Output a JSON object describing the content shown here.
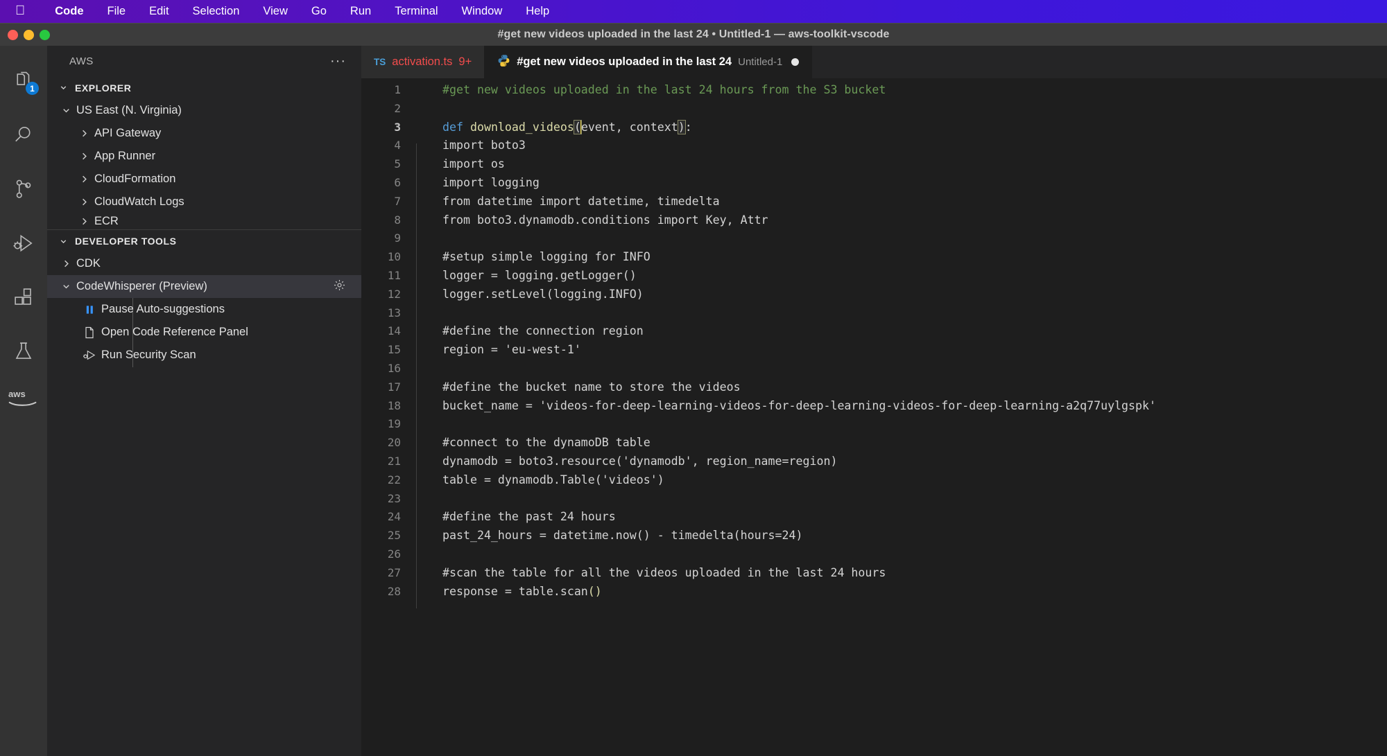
{
  "menubar": {
    "apple_icon": "apple-logo-icon",
    "items": [
      {
        "label": "Code",
        "bold": true
      },
      {
        "label": "File",
        "bold": false
      },
      {
        "label": "Edit",
        "bold": false
      },
      {
        "label": "Selection",
        "bold": false
      },
      {
        "label": "View",
        "bold": false
      },
      {
        "label": "Go",
        "bold": false
      },
      {
        "label": "Run",
        "bold": false
      },
      {
        "label": "Terminal",
        "bold": false
      },
      {
        "label": "Window",
        "bold": false
      },
      {
        "label": "Help",
        "bold": false
      }
    ]
  },
  "window": {
    "title": "#get new videos uploaded in the last 24 • Untitled-1 — aws-toolkit-vscode",
    "traffic_lights": [
      "close-red",
      "minimize-yellow",
      "zoom-green"
    ]
  },
  "activitybar": {
    "items": [
      {
        "name": "explorer-icon",
        "badge": "1"
      },
      {
        "name": "search-icon",
        "badge": ""
      },
      {
        "name": "source-control-icon",
        "badge": ""
      },
      {
        "name": "run-and-debug-icon",
        "badge": ""
      },
      {
        "name": "extensions-icon",
        "badge": ""
      },
      {
        "name": "testing-beaker-icon",
        "badge": ""
      }
    ],
    "aws_logo": "aws-icon"
  },
  "sidebar": {
    "title": "AWS",
    "more_actions": "···",
    "explorer": {
      "label": "EXPLORER",
      "expanded": true,
      "region": {
        "label": "US East (N. Virginia)",
        "expanded": true,
        "services": [
          {
            "label": "API Gateway",
            "expanded": false
          },
          {
            "label": "App Runner",
            "expanded": false
          },
          {
            "label": "CloudFormation",
            "expanded": false
          },
          {
            "label": "CloudWatch Logs",
            "expanded": false
          },
          {
            "label": "ECR",
            "expanded": false
          }
        ]
      }
    },
    "developer_tools": {
      "label": "DEVELOPER TOOLS",
      "expanded": true,
      "items": [
        {
          "label": "CDK",
          "expanded": false,
          "selected": false
        },
        {
          "label": "CodeWhisperer (Preview)",
          "expanded": true,
          "selected": true,
          "gear": "gear-icon"
        }
      ],
      "codewhisperer_actions": [
        {
          "label": "Pause Auto-suggestions",
          "icon": "pause-icon"
        },
        {
          "label": "Open Code Reference Panel",
          "icon": "file-icon"
        },
        {
          "label": "Run Security Scan",
          "icon": "security-scan-icon"
        }
      ]
    }
  },
  "tabs": [
    {
      "label": "activation.ts",
      "icon": "typescript-icon",
      "icon_text": "TS",
      "count": "9+",
      "active": false,
      "dirty": false
    },
    {
      "label": "#get new videos uploaded in the last 24",
      "icon": "python-icon",
      "sublabel": "Untitled-1",
      "active": true,
      "dirty": true
    }
  ],
  "code": {
    "language": "python",
    "cursor_line": 3,
    "lines": [
      {
        "n": "1",
        "indent": 0,
        "tokens": [
          {
            "t": "#get new videos uploaded in the last 24 hours from the S3 bucket",
            "c": "cm"
          }
        ]
      },
      {
        "n": "2",
        "indent": 0,
        "tokens": []
      },
      {
        "n": "3",
        "indent": 0,
        "current": true,
        "tokens": [
          {
            "t": "def ",
            "c": "kw"
          },
          {
            "t": "download_videos",
            "c": "fn"
          },
          {
            "t": "(",
            "c": "br"
          },
          {
            "t": "event, context",
            "c": "src"
          },
          {
            "t": ")",
            "c": "br"
          },
          {
            "t": ":",
            "c": "src"
          }
        ]
      },
      {
        "n": "4",
        "indent": 1,
        "tokens": [
          {
            "t": "import boto3",
            "c": "src"
          }
        ]
      },
      {
        "n": "5",
        "indent": 1,
        "tokens": [
          {
            "t": "import os",
            "c": "src"
          }
        ]
      },
      {
        "n": "6",
        "indent": 1,
        "tokens": [
          {
            "t": "import logging",
            "c": "src"
          }
        ]
      },
      {
        "n": "7",
        "indent": 1,
        "tokens": [
          {
            "t": "from datetime import datetime, timedelta",
            "c": "src"
          }
        ]
      },
      {
        "n": "8",
        "indent": 1,
        "tokens": [
          {
            "t": "from boto3.dynamodb.conditions import Key, Attr",
            "c": "src"
          }
        ]
      },
      {
        "n": "9",
        "indent": 1,
        "tokens": []
      },
      {
        "n": "10",
        "indent": 1,
        "tokens": [
          {
            "t": "#setup simple logging for INFO",
            "c": "src"
          }
        ]
      },
      {
        "n": "11",
        "indent": 1,
        "tokens": [
          {
            "t": "logger = logging.getLogger()",
            "c": "src"
          }
        ]
      },
      {
        "n": "12",
        "indent": 1,
        "tokens": [
          {
            "t": "logger.setLevel(logging.INFO)",
            "c": "src"
          }
        ]
      },
      {
        "n": "13",
        "indent": 1,
        "tokens": []
      },
      {
        "n": "14",
        "indent": 1,
        "tokens": [
          {
            "t": "#define the connection region",
            "c": "src"
          }
        ]
      },
      {
        "n": "15",
        "indent": 1,
        "tokens": [
          {
            "t": "region = 'eu-west-1'",
            "c": "src"
          }
        ]
      },
      {
        "n": "16",
        "indent": 1,
        "tokens": []
      },
      {
        "n": "17",
        "indent": 1,
        "tokens": [
          {
            "t": "#define the bucket name to store the videos",
            "c": "src"
          }
        ]
      },
      {
        "n": "18",
        "indent": 1,
        "tokens": [
          {
            "t": "bucket_name = 'videos-for-deep-learning-videos-for-deep-learning-videos-for-deep-learning-a2q77uylgspk'",
            "c": "src"
          }
        ]
      },
      {
        "n": "19",
        "indent": 1,
        "tokens": []
      },
      {
        "n": "20",
        "indent": 1,
        "tokens": [
          {
            "t": "#connect to the dynamoDB table",
            "c": "src"
          }
        ]
      },
      {
        "n": "21",
        "indent": 1,
        "tokens": [
          {
            "t": "dynamodb = boto3.resource('dynamodb', region_name=region)",
            "c": "src"
          }
        ]
      },
      {
        "n": "22",
        "indent": 1,
        "tokens": [
          {
            "t": "table = dynamodb.Table('videos')",
            "c": "src"
          }
        ]
      },
      {
        "n": "23",
        "indent": 1,
        "tokens": []
      },
      {
        "n": "24",
        "indent": 1,
        "tokens": [
          {
            "t": "#define the past 24 hours",
            "c": "src"
          }
        ]
      },
      {
        "n": "25",
        "indent": 1,
        "tokens": [
          {
            "t": "past_24_hours = datetime.now() - timedelta(hours=24)",
            "c": "src"
          }
        ]
      },
      {
        "n": "26",
        "indent": 1,
        "tokens": []
      },
      {
        "n": "27",
        "indent": 1,
        "tokens": [
          {
            "t": "#scan the table for all the videos uploaded in the last 24 hours",
            "c": "src"
          }
        ]
      },
      {
        "n": "28",
        "indent": 1,
        "tokens": [
          {
            "t": "response = table.scan",
            "c": "src"
          },
          {
            "t": "(",
            "c": "fn"
          },
          {
            "t": ")",
            "c": "fn"
          }
        ]
      }
    ]
  },
  "colors": {
    "menubar_start": "#5b0fb0",
    "menubar_end": "#3a18e0",
    "titlebar": "#3c3c3c",
    "sidebar_bg": "#252526",
    "activitybar_bg": "#333333",
    "editor_bg": "#1e1e1e",
    "comment_green": "#6a9955",
    "keyword_blue": "#569cd6",
    "function_yellow": "#dcdcaa",
    "error_red": "#f14c4c",
    "badge_blue": "#0e7ad4",
    "selection": "#37373d"
  }
}
